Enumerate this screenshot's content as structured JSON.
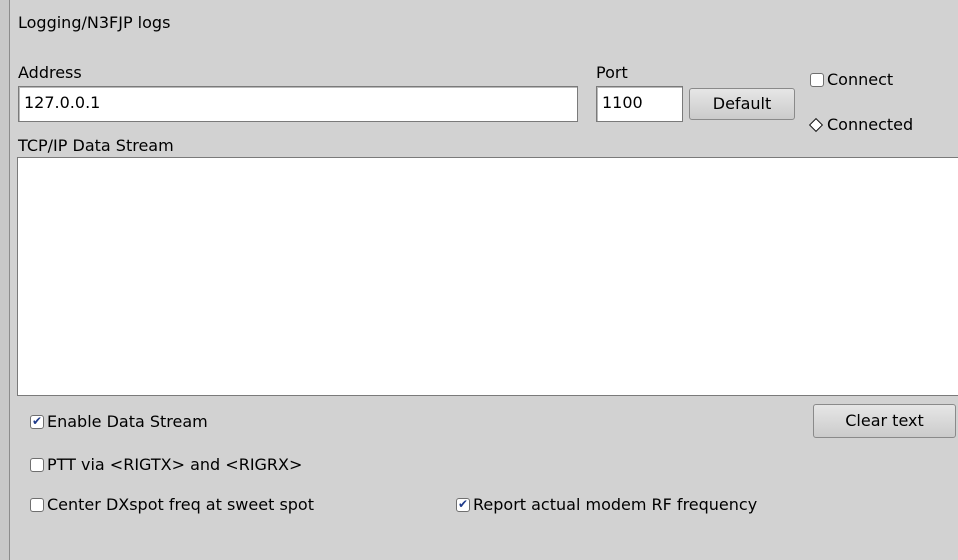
{
  "group_title": "Logging/N3FJP logs",
  "address": {
    "label": "Address",
    "value": "127.0.0.1"
  },
  "port": {
    "label": "Port",
    "value": "1100"
  },
  "default_button": "Default",
  "connect": {
    "label": "Connect",
    "checked": false
  },
  "connected": {
    "label": "Connected"
  },
  "stream": {
    "label": "TCP/IP Data Stream",
    "text": ""
  },
  "options": {
    "enable_data_stream": {
      "label": "Enable Data Stream",
      "checked": true
    },
    "ptt_via": {
      "label": "PTT via <RIGTX> and <RIGRX>",
      "checked": false
    },
    "center_dxspot": {
      "label": "Center DXspot freq at sweet spot",
      "checked": false
    },
    "report_rf": {
      "label": "Report actual modem RF frequency",
      "checked": true
    }
  },
  "clear_button": "Clear text",
  "check_glyph": "✔"
}
